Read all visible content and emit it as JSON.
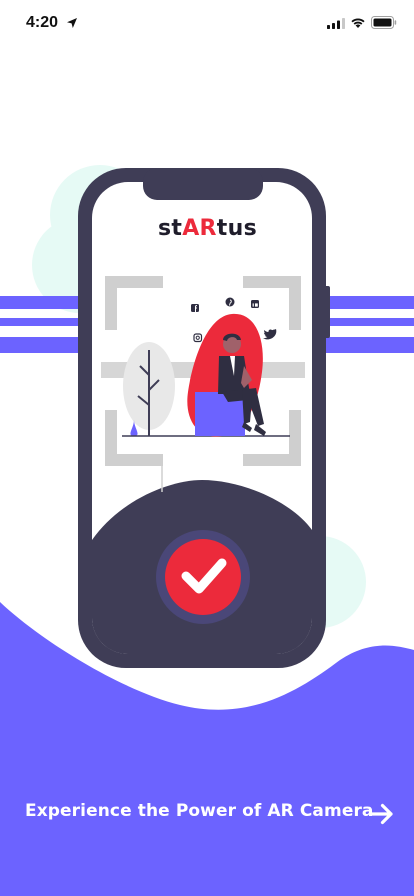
{
  "status_bar": {
    "time": "4:20",
    "icons": [
      "location-arrow-icon",
      "cellular-signal-icon",
      "wifi-icon",
      "battery-icon"
    ]
  },
  "brand": {
    "prefix": "st",
    "highlight": "AR",
    "suffix": "tus"
  },
  "illustration": {
    "social_icons": [
      "facebook-icon",
      "pinterest-icon",
      "linkedin-icon",
      "instagram-icon",
      "twitter-icon"
    ],
    "center_badge_icon": "check-icon"
  },
  "footer": {
    "cta_label": "Experience the Power of AR Camera",
    "next_icon": "arrow-right-icon"
  },
  "colors": {
    "primary": "#6c63ff",
    "accent": "#ec2a3b",
    "phone_dark": "#3f3d56",
    "mint": "#e3f8f4",
    "scan_gray": "#cfcfcf"
  }
}
